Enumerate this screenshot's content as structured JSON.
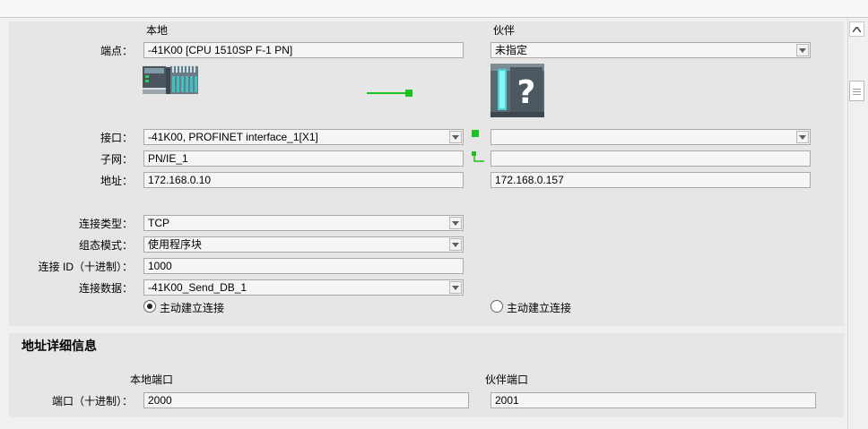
{
  "headers": {
    "local": "本地",
    "partner": "伙伴"
  },
  "endpoint": {
    "label": "端点：",
    "local_value": "-41K00 [CPU 1510SP F-1 PN]",
    "partner_value": "未指定"
  },
  "interface": {
    "label": "接口：",
    "local_value": "-41K00, PROFINET interface_1[X1]",
    "partner_value": ""
  },
  "subnet": {
    "label": "子网：",
    "local_value": "PN/IE_1",
    "partner_value": ""
  },
  "address": {
    "label": "地址：",
    "local_value": "172.168.0.10",
    "partner_value": "172.168.0.157"
  },
  "connection_type": {
    "label": "连接类型：",
    "value": "TCP"
  },
  "config_mode": {
    "label": "组态模式：",
    "value": "使用程序块"
  },
  "connection_id": {
    "label": "连接 ID（十进制）：",
    "value": "1000"
  },
  "connection_data": {
    "label": "连接数据：",
    "value": "-41K00_Send_DB_1"
  },
  "active_connection": {
    "local_label": "主动建立连接",
    "local_selected": true,
    "partner_label": "主动建立连接",
    "partner_selected": false
  },
  "address_details": {
    "title": "地址详细信息",
    "local_port_header": "本地端口",
    "partner_port_header": "伙伴端口",
    "port_label": "端口（十进制）：",
    "local_port": "2000",
    "partner_port": "2001"
  },
  "icons": {
    "local_device": "cpu-rack-icon",
    "partner_device": "unknown-device-icon",
    "link": "connection-line-icon",
    "subnet_link": "subnet-link-icon"
  },
  "colors": {
    "link_green": "#1ec21e",
    "panel_bg": "#e6e6e6",
    "field_border": "#a9a9a9"
  }
}
